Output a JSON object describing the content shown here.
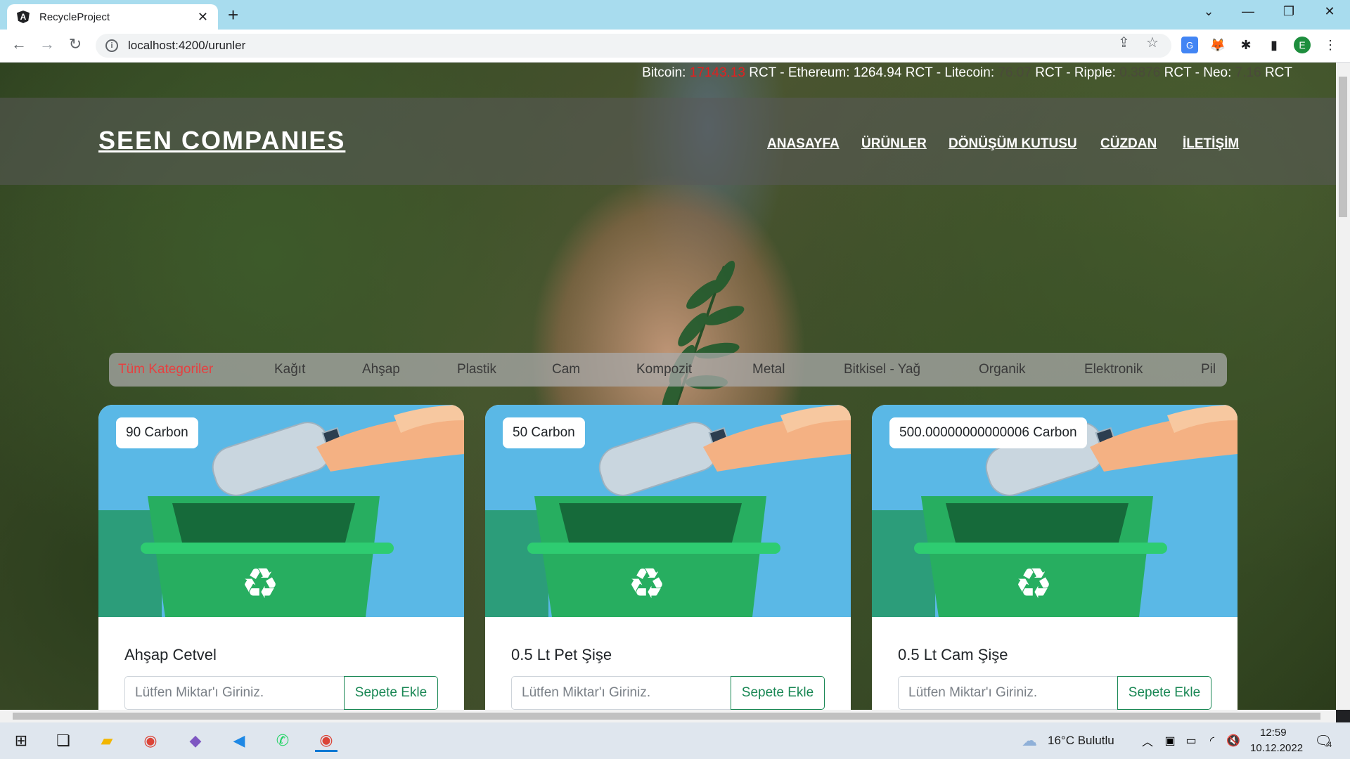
{
  "browser": {
    "tab_title": "RecycleProject",
    "tab_close": "✕",
    "new_tab": "+",
    "url": "localhost:4200/urunler",
    "profile_initial": "E"
  },
  "ticker": {
    "segments": [
      {
        "label": "Bitcoin:",
        "value": "17143.13",
        "unit": "RCT -"
      },
      {
        "label": "Ethereum:",
        "value": "1264.94",
        "unit": "RCT -"
      },
      {
        "label": "Litecoin:",
        "value": "76.07",
        "unit": "RCT -"
      },
      {
        "label": "Ripple:",
        "value": "0.3876",
        "unit": "RCT -"
      },
      {
        "label": "Neo:",
        "value": "7.16",
        "unit": "RCT"
      }
    ]
  },
  "header": {
    "brand": "SEEN COMPANIES",
    "nav": [
      "ANASAYFA",
      "ÜRÜNLER",
      "DÖNÜŞÜM KUTUSU",
      "CÜZDAN",
      "İLETİŞİM"
    ]
  },
  "categories": [
    "Tüm Kategoriler",
    "Kağıt",
    "Ahşap",
    "Plastik",
    "Cam",
    "Kompozit",
    "Metal",
    "Bitkisel - Yağ",
    "Organik",
    "Elektronik",
    "Pil"
  ],
  "products": [
    {
      "badge": "90 Carbon",
      "title": "Ahşap Cetvel",
      "placeholder": "Lütfen Miktar'ı Giriniz.",
      "button": "Sepete Ekle"
    },
    {
      "badge": "50 Carbon",
      "title": "0.5 Lt Pet Şişe",
      "placeholder": "Lütfen Miktar'ı Giriniz.",
      "button": "Sepete Ekle"
    },
    {
      "badge": "500.00000000000006 Carbon",
      "title": "0.5 Lt Cam Şişe",
      "placeholder": "Lütfen Miktar'ı Giriniz.",
      "button": "Sepete Ekle"
    }
  ],
  "taskbar": {
    "weather": "16°C  Bulutlu",
    "time": "12:59",
    "date": "10.12.2022",
    "notifications": "4"
  },
  "colors": {
    "accent_green": "#198754",
    "active_category": "#e64040",
    "card_sky": "#5ab8e6",
    "bin_green": "#27ae60"
  }
}
